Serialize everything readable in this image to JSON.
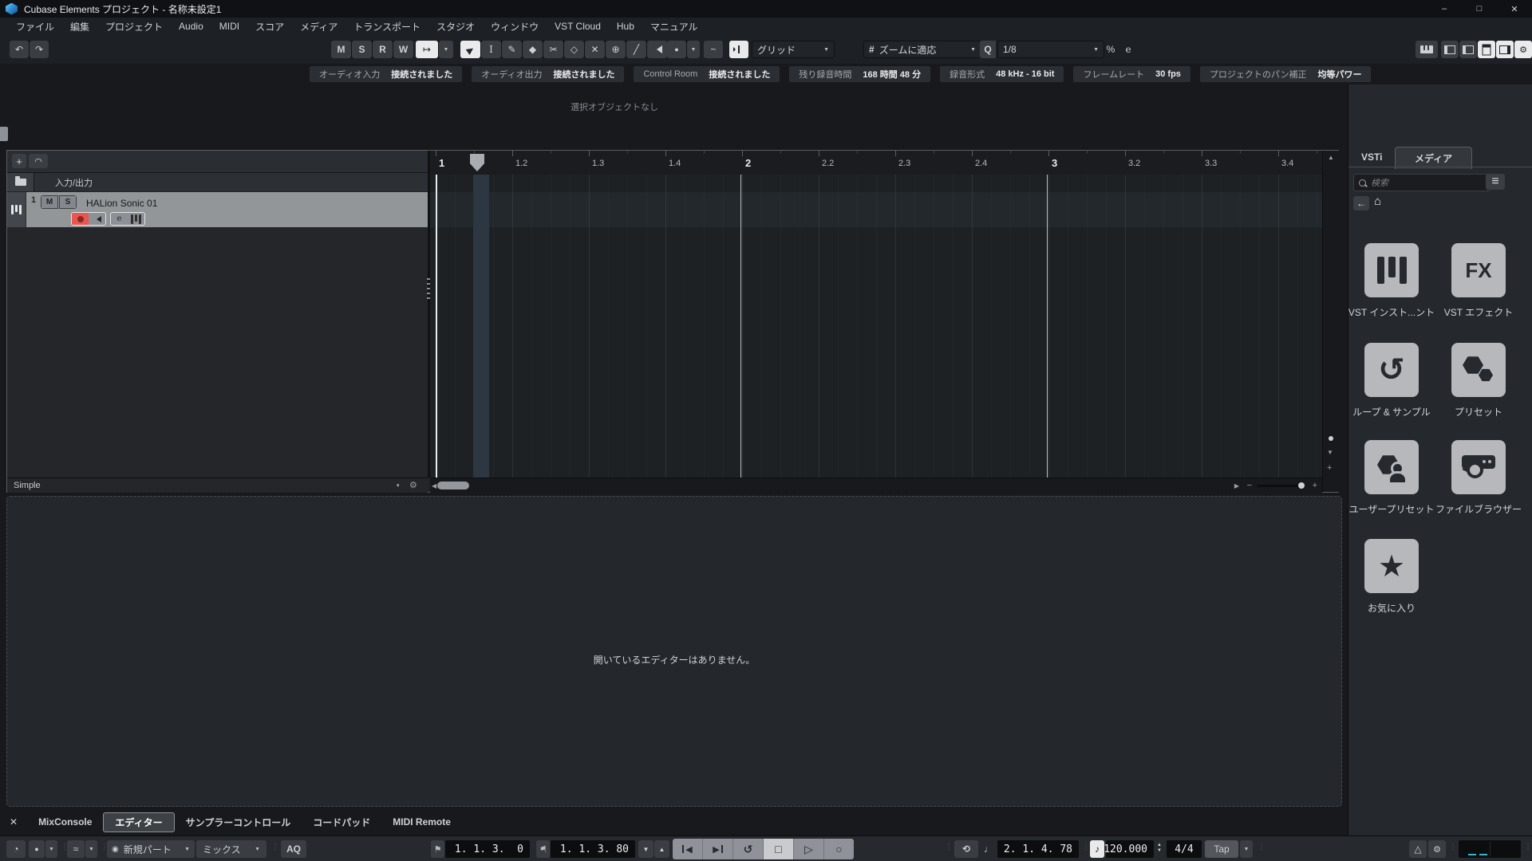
{
  "titlebar": {
    "title": "Cubase Elements プロジェクト - 名称未設定1"
  },
  "menubar": {
    "items": [
      "ファイル",
      "編集",
      "プロジェクト",
      "Audio",
      "MIDI",
      "スコア",
      "メディア",
      "トランスポート",
      "スタジオ",
      "ウィンドウ",
      "VST Cloud",
      "Hub",
      "マニュアル"
    ]
  },
  "toolbar": {
    "msrw": [
      "M",
      "S",
      "R",
      "W"
    ],
    "grid_mode": "グリッド",
    "zoom_mode": "ズームに適応",
    "quantize": "1/8",
    "quantize_letter": "Q",
    "hash": "#",
    "percent": "%",
    "e": "e"
  },
  "infobar": {
    "items": [
      {
        "label": "オーディオ入力",
        "value": "接続されました"
      },
      {
        "label": "オーディオ出力",
        "value": "接続されました"
      },
      {
        "label": "Control Room",
        "value": "接続されました"
      },
      {
        "label": "残り録音時間",
        "value": "168 時間 48 分"
      },
      {
        "label": "録音形式",
        "value": "48 kHz - 16 bit"
      },
      {
        "label": "フレームレート",
        "value": "30 fps"
      },
      {
        "label": "プロジェクトのパン補正",
        "value": "均等パワー"
      }
    ]
  },
  "status_line": "選択オブジェクトなし",
  "project": {
    "io_label": "入力/出力",
    "track_number": "1",
    "track_name": "HALion Sonic 01",
    "mute": "M",
    "solo": "S",
    "edit_letter": "e",
    "preset_name": "Simple",
    "ruler_ticks": [
      "1",
      "1.2",
      "1.3",
      "1.4",
      "2",
      "2.2",
      "2.3",
      "2.4",
      "3",
      "3.2",
      "3.3",
      "3.4"
    ]
  },
  "lower_zone": {
    "message": "開いているエディターはありません。",
    "tabs": [
      "MixConsole",
      "エディター",
      "サンプラーコントロール",
      "コードパッド",
      "MIDI Remote"
    ]
  },
  "right_zone": {
    "tabs": [
      "VSTi",
      "メディア"
    ],
    "search_placeholder": "検索",
    "tiles": [
      {
        "label": "VST インスト...ント"
      },
      {
        "label": "VST エフェクト"
      },
      {
        "label": "ループ & サンプル"
      },
      {
        "label": "プリセット"
      },
      {
        "label": "ユーザープリセット"
      },
      {
        "label": "ファイルブラウザー"
      },
      {
        "label": "お気に入り"
      }
    ]
  },
  "transport": {
    "aq": "AQ",
    "rec_part_mode": "新規パート",
    "rec_mix_mode": "ミックス",
    "left_locator": "1. 1. 3.  0",
    "right_locator": "1. 1. 3. 80",
    "position": "2. 1. 4. 78",
    "tempo": "120.000",
    "time_sig": "4/4",
    "tap": "Tap"
  },
  "icons": {
    "undo": "↶",
    "redo": "↷",
    "caret_down": "▼",
    "minimize": "–",
    "maximize": "□",
    "close": "✕",
    "add": "+",
    "preset_hat": "◠",
    "select": "▶",
    "range": "I",
    "draw": "✎",
    "erase": "◆",
    "split": "✂",
    "glue": "◇",
    "mute": "✕",
    "zoom": "⊕",
    "line": "╱",
    "comp": "●",
    "curve": "~",
    "autoscroll": "↦",
    "clock": "◔",
    "rec_dot": "●",
    "wave": "≈",
    "midi": "◉",
    "flag": "⚑",
    "punch_in": "▼",
    "punch_out": "▲",
    "cycle": "↺",
    "stop": "□",
    "play": "▷",
    "record": "○",
    "skip_back": "◀",
    "skip_fwd": "▶",
    "jog": "⟲",
    "note": "♩",
    "tempo_note": "♪",
    "metronome": "△",
    "gear": "⚙",
    "sep_dots": "⋮",
    "list": "≡",
    "back": "←",
    "home": "⌂",
    "loop": "↺",
    "star": "★",
    "fx": "FX",
    "scroll_up": "▲",
    "scroll_down": "▼",
    "scroll_left": "◀",
    "scroll_right": "▶",
    "minus": "−",
    "plus": "+",
    "dd_arrow": "▾",
    "gear_small": "⚙"
  }
}
